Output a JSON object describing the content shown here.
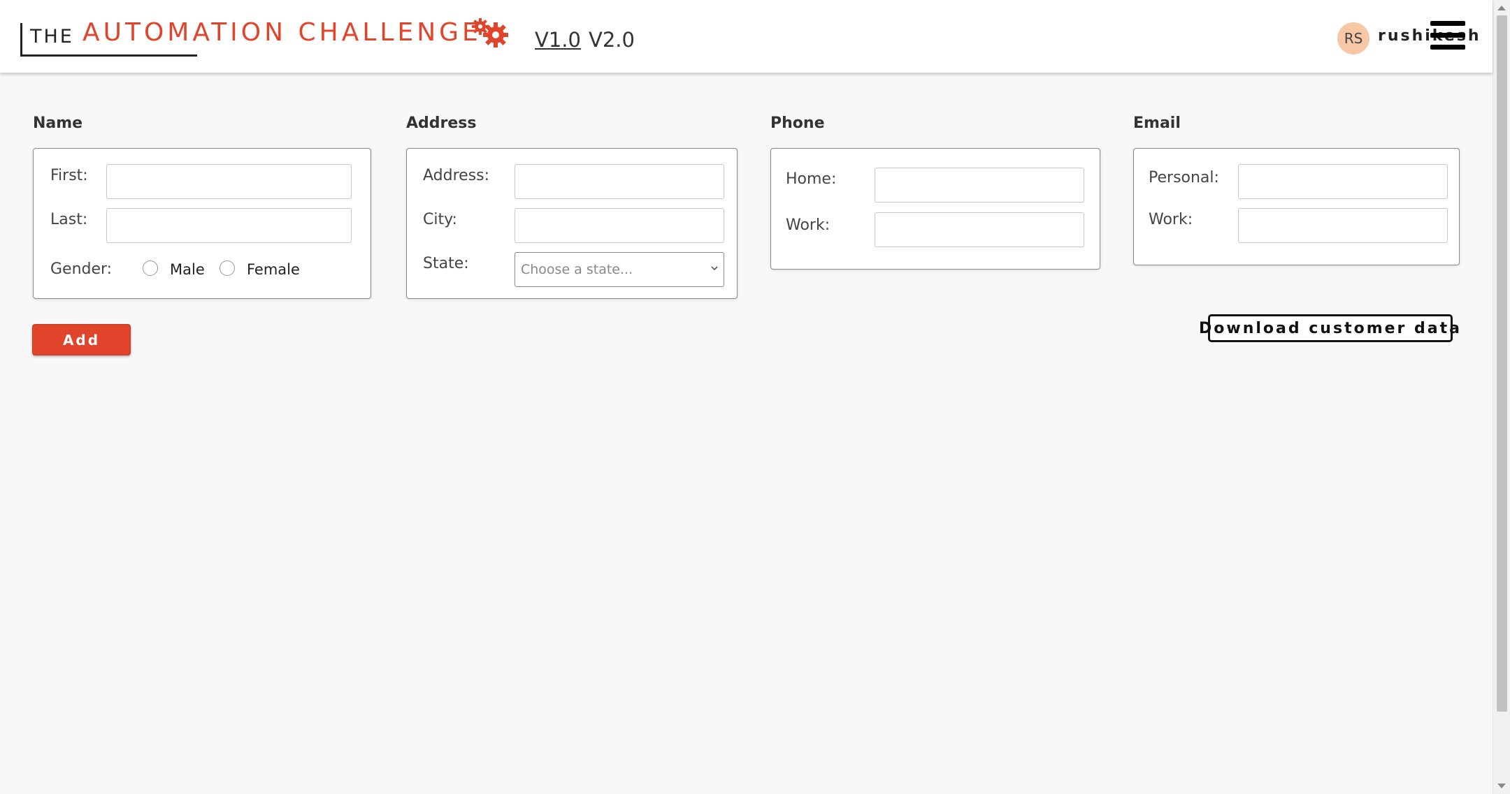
{
  "header": {
    "logo_prefix": "THE",
    "logo_title": "AUTOMATION CHALLENGE",
    "logo_icon": "gears-icon",
    "versions": [
      "V1.0",
      "V2.0"
    ],
    "avatar_initials": "RS",
    "username": "rushikesh",
    "menu_icon": "hamburger-menu-icon"
  },
  "colors": {
    "accent": "#e0442a",
    "avatar_bg": "#f7c7a6",
    "page_bg": "#f8f8f8"
  },
  "name_section": {
    "title": "Name",
    "first_label": "First:",
    "first_value": "",
    "last_label": "Last:",
    "last_value": "",
    "gender_label": "Gender:",
    "gender_options": [
      "Male",
      "Female"
    ]
  },
  "address_section": {
    "title": "Address",
    "address_label": "Address:",
    "address_value": "",
    "city_label": "City:",
    "city_value": "",
    "state_label": "State:",
    "state_placeholder": "Choose a state..."
  },
  "phone_section": {
    "title": "Phone",
    "home_label": "Home:",
    "home_value": "",
    "work_label": "Work:",
    "work_value": ""
  },
  "email_section": {
    "title": "Email",
    "personal_label": "Personal:",
    "personal_value": "",
    "work_label": "Work:",
    "work_value": ""
  },
  "actions": {
    "add_label": "Add",
    "download_label": "Download customer data"
  }
}
